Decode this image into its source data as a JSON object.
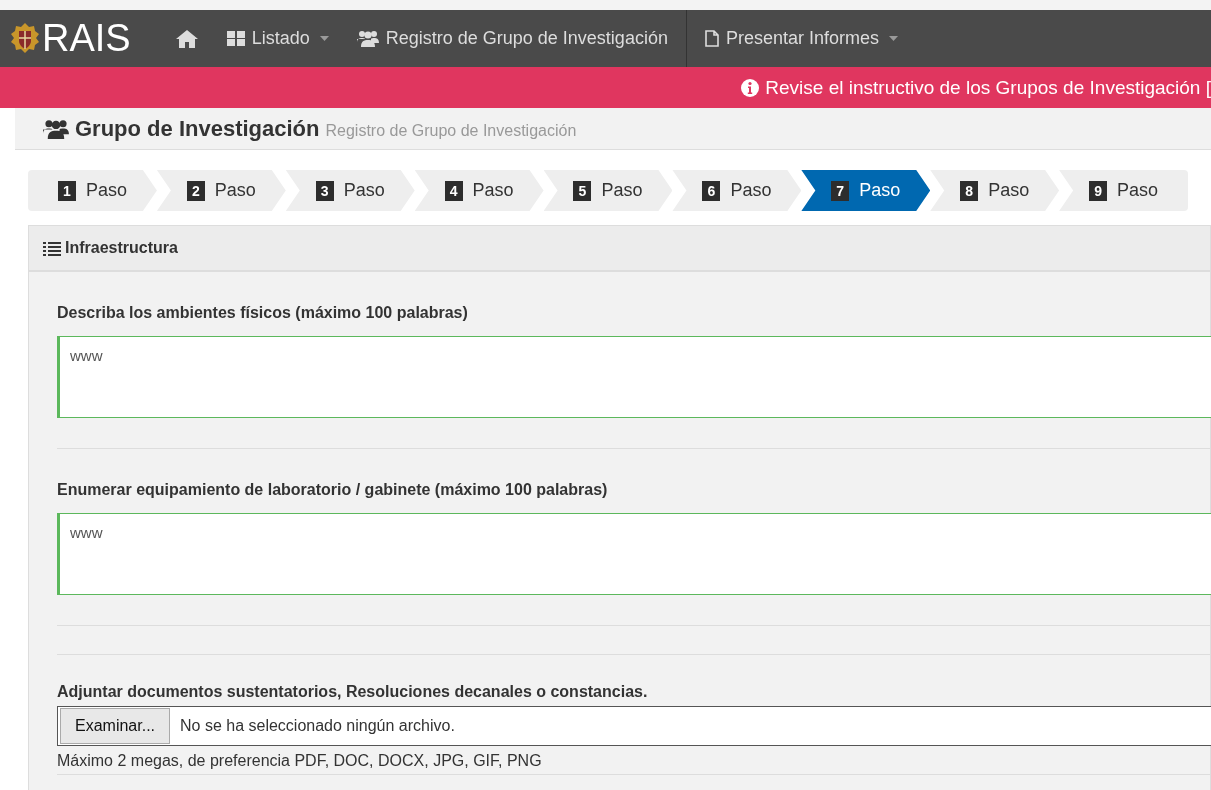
{
  "navbar": {
    "brand": "RAIS",
    "items": [
      {
        "kind": "home"
      },
      {
        "kind": "dropdown",
        "label": "Listado"
      },
      {
        "kind": "link",
        "label": "Registro de Grupo de Investigación"
      },
      {
        "kind": "dropdown",
        "label": "Presentar Informes"
      }
    ]
  },
  "alert": {
    "text": "Revise el instructivo de los Grupos de Investigación ["
  },
  "page_header": {
    "title": "Grupo de Investigación",
    "subtitle": "Registro de Grupo de Investigación"
  },
  "steps": [
    {
      "number": "1",
      "label": "Paso",
      "selected": false
    },
    {
      "number": "2",
      "label": "Paso",
      "selected": false
    },
    {
      "number": "3",
      "label": "Paso",
      "selected": false
    },
    {
      "number": "4",
      "label": "Paso",
      "selected": false
    },
    {
      "number": "5",
      "label": "Paso",
      "selected": false
    },
    {
      "number": "6",
      "label": "Paso",
      "selected": false
    },
    {
      "number": "7",
      "label": "Paso",
      "selected": true
    },
    {
      "number": "8",
      "label": "Paso",
      "selected": false
    },
    {
      "number": "9",
      "label": "Paso",
      "selected": false
    }
  ],
  "panel": {
    "title": "Infraestructura",
    "fields": [
      {
        "kind": "textarea",
        "label": "Describa los ambientes físicos (máximo 100 palabras)",
        "value": "www"
      },
      {
        "kind": "textarea",
        "label": "Enumerar equipamiento de laboratorio / gabinete (máximo 100 palabras)",
        "value": "www"
      },
      {
        "kind": "file",
        "label": "Adjuntar documentos sustentatorios, Resoluciones decanales o constancias.",
        "button": "Examinar...",
        "status": "No se ha seleccionado ningún archivo.",
        "help": "Máximo 2 megas, de preferencia PDF, DOC, DOCX, JPG, GIF, PNG"
      }
    ]
  }
}
